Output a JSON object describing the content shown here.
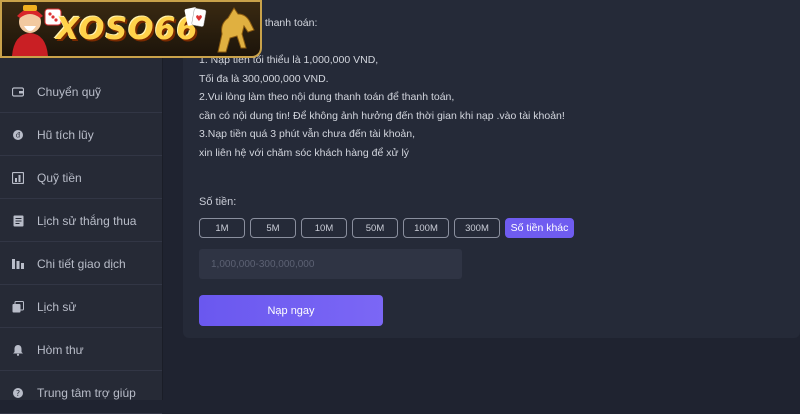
{
  "logo": {
    "text": "XOSO66"
  },
  "instructions": {
    "heading_partial": ": thanh toán:",
    "lines": [
      "1. Nạp tiền tối thiểu là 1,000,000 VND,",
      "Tối đa là 300,000,000 VND.",
      "2.Vui lòng làm theo nội dung thanh toán để thanh toán,",
      "cần có nội dung tin! Để không ảnh hưởng đến thời gian khi nạp .vào tài khoản!",
      "3.Nạp tiền quá 3 phút vẫn chưa đến tài khoản,",
      "xin liên hệ với chăm sóc khách hàng để xử lý"
    ]
  },
  "sidebar": {
    "items": [
      {
        "label": "Chuyển quỹ",
        "icon": "wallet-icon"
      },
      {
        "label": "Hũ tích lũy",
        "icon": "coin-icon"
      },
      {
        "label": "Quỹ tiền",
        "icon": "fund-icon"
      },
      {
        "label": "Lịch sử thắng thua",
        "icon": "document-icon"
      },
      {
        "label": "Chi tiết giao dịch",
        "icon": "ledger-icon"
      },
      {
        "label": "Lịch sử",
        "icon": "history-icon"
      },
      {
        "label": "Hòm thư",
        "icon": "bell-icon"
      },
      {
        "label": "Trung tâm trợ giúp",
        "icon": "help-icon"
      }
    ]
  },
  "form": {
    "amount_label": "Số tiền:",
    "presets": [
      "1M",
      "5M",
      "10M",
      "50M",
      "100M",
      "300M"
    ],
    "other_amount_label": "Số tiền khác",
    "input_placeholder": "1,000,000-300,000,000",
    "input_value": "",
    "submit_label": "Nạp ngay"
  },
  "colors": {
    "accent": "#6f5cf0",
    "background": "#1f2330",
    "panel": "#252a38",
    "sidebar": "#262a36",
    "logo_gold": "#ffd24a"
  }
}
